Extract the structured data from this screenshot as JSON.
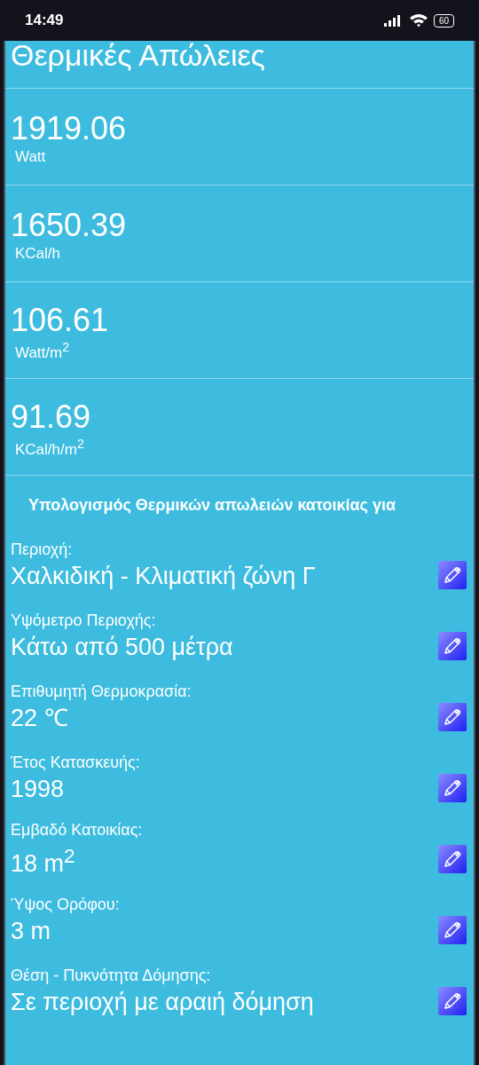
{
  "status_bar": {
    "time": "14:49",
    "battery": "60"
  },
  "title": "Θερμικές Απώλειες",
  "results": [
    {
      "value": "1919.06",
      "unit": "Watt"
    },
    {
      "value": "1650.39",
      "unit": "KCal/h"
    },
    {
      "value": "106.61",
      "unit": "Watt/m$^{2}$"
    },
    {
      "value": "91.69",
      "unit": "KCal/h/m$^{2}$"
    }
  ],
  "section_heading": "Υπολογισμός Θερμικών απωλειών κατοικίας για",
  "fields": [
    {
      "label": "Περιοχή:",
      "value": "Χαλκιδική - Κλιματική ζώνη Γ"
    },
    {
      "label": "Υψόμετρο Περιοχής:",
      "value": "Κάτω από 500 μέτρα"
    },
    {
      "label": "Επιθυμητή Θερμοκρασία:",
      "value": "22 ℃"
    },
    {
      "label": "Έτος Κατασκευής:",
      "value": "1998"
    },
    {
      "label": "Εμβαδό Κατοικίας:",
      "value": "18 m$^{2}$"
    },
    {
      "label": "Ύψος Ορόφου:",
      "value": "3 m"
    },
    {
      "label": "Θέση - Πυκνότητα Δόμησης:",
      "value": "Σε περιοχή με αραιή δόμηση"
    }
  ]
}
